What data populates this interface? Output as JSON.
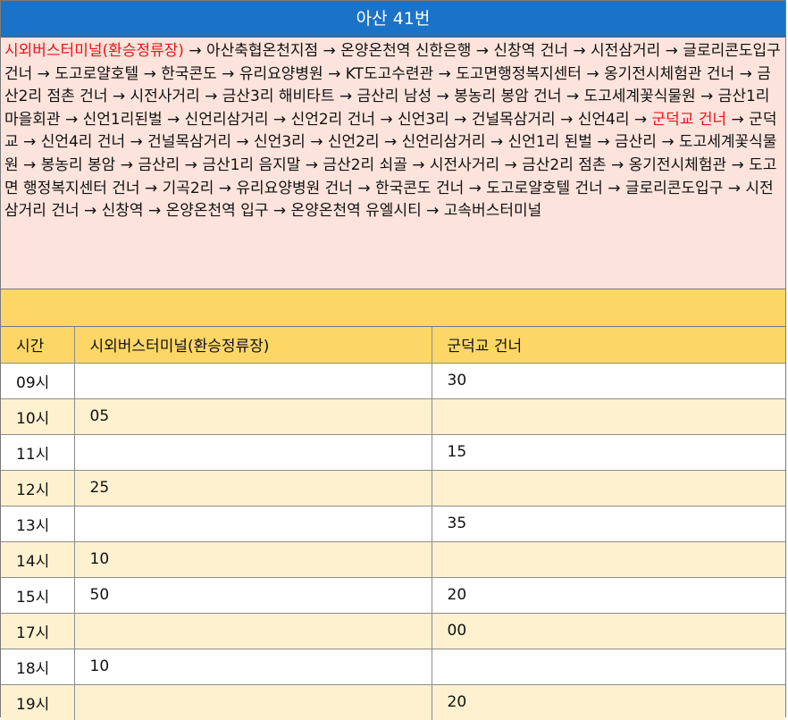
{
  "title": "아산 41번",
  "route": {
    "origin": "시외버스터미널(환승정류장)",
    "segment1": " → 아산축협온천지점 → 온양온천역 신한은행 → 신창역 건너 → 시전삼거리 → 글로리콘도입구 건너 → 도고로얄호텔 → 한국콘도 → 유리요양병원 → KT도고수련관 → 도고면행정복지센터 → 옹기전시체험관 건너 → 금산2리 점촌 건너 → 시전사거리 → 금산3리 해비타트 → 금산리 남성 → 봉농리 봉암 건너 → 도고세계꽃식물원 → 금산1리 마을회관 → 신언1리된벌 → 신언리삼거리 → 신언2리 건너 → 신언3리 → 건널목삼거리 → 신언4리 → ",
    "turnaround": "군덕교 건너",
    "segment2": " → 군덕교 → 신언4리 건너 → 건널목삼거리 → 신언3리 → 신언2리 → 신언리삼거리 → 신언1리 된벌 → 금산리 → 도고세계꽃식물원 → 봉농리 봉암 → 금산리 → 금산1리 음지말 → 금산2리 쇠골 → 시전사거리 → 금산2리 점촌 → 옹기전시체험관 → 도고면 행정복지센터 건너 → 기곡2리 → 유리요양병원 건너 → 한국콘도 건너 → 도고로얄호텔 건너 → 글로리콘도입구 → 시전삼거리 건너 → 신창역 → 온양온천역 입구 → 온양온천역 유엘시티 → 고속버스터미널"
  },
  "colors": {
    "title_bg": "#1b73c7",
    "route_bg": "#fce4dc",
    "highlight": "#e8141b",
    "header_bg": "#fdd766",
    "alt_row_bg": "#fdf1d0"
  },
  "table": {
    "headers": [
      "시간",
      "시외버스터미널(환승정류장)",
      "군덕교 건너"
    ],
    "rows": [
      [
        "09시",
        "",
        "30"
      ],
      [
        "10시",
        "05",
        ""
      ],
      [
        "11시",
        "",
        "15"
      ],
      [
        "12시",
        "25",
        ""
      ],
      [
        "13시",
        "",
        "35"
      ],
      [
        "14시",
        "10",
        ""
      ],
      [
        "15시",
        "50",
        "20"
      ],
      [
        "17시",
        "",
        "00"
      ],
      [
        "18시",
        "10",
        ""
      ],
      [
        "19시",
        "",
        "20"
      ]
    ]
  }
}
